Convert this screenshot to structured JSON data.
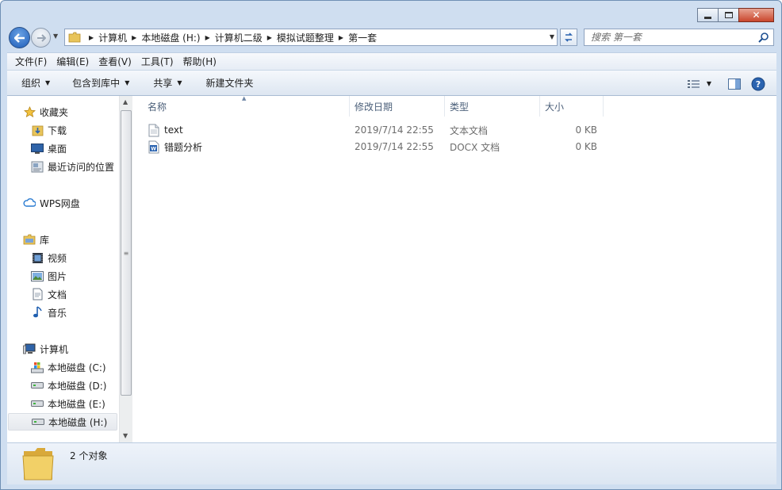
{
  "window": {
    "min_label": "",
    "max_label": "",
    "close_label": "✕"
  },
  "address": {
    "crumbs": [
      "计算机",
      "本地磁盘 (H:)",
      "计算机二级",
      "模拟试题整理",
      "第一套"
    ]
  },
  "search": {
    "placeholder": "搜索 第一套"
  },
  "menubar": {
    "items": [
      "文件(F)",
      "编辑(E)",
      "查看(V)",
      "工具(T)",
      "帮助(H)"
    ]
  },
  "toolbar": {
    "organize": "组织",
    "include_library": "包含到库中",
    "share": "共享",
    "new_folder": "新建文件夹"
  },
  "nav": {
    "favorites": "收藏夹",
    "downloads": "下载",
    "desktop": "桌面",
    "recent": "最近访问的位置",
    "wps": "WPS网盘",
    "libraries": "库",
    "videos": "视频",
    "pictures": "图片",
    "documents": "文档",
    "music": "音乐",
    "computer": "计算机",
    "drive_c": "本地磁盘 (C:)",
    "drive_d": "本地磁盘 (D:)",
    "drive_e": "本地磁盘 (E:)",
    "drive_h": "本地磁盘 (H:)"
  },
  "columns": {
    "name": "名称",
    "date": "修改日期",
    "type": "类型",
    "size": "大小"
  },
  "files": [
    {
      "name": "text",
      "date": "2019/7/14 22:55",
      "type": "文本文档",
      "size": "0 KB",
      "icon": "text-file-icon"
    },
    {
      "name": "错题分析",
      "date": "2019/7/14 22:55",
      "type": "DOCX 文档",
      "size": "0 KB",
      "icon": "docx-file-icon"
    }
  ],
  "status": {
    "count": "2 个对象"
  },
  "colors": {
    "accent": "#2a63b0",
    "frame": "#cfdef0"
  }
}
